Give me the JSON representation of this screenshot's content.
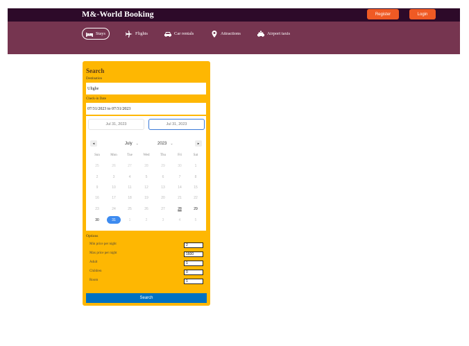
{
  "header": {
    "brand": "M&-World Booking",
    "register_label": "Register",
    "login_label": "Login",
    "colors": {
      "topbar": "#2d0a29",
      "nav": "#763550",
      "button": "#f05a24"
    }
  },
  "nav": {
    "items": [
      {
        "label": "Stays",
        "icon": "bed-icon",
        "active": true
      },
      {
        "label": "Flights",
        "icon": "plane-icon",
        "active": false
      },
      {
        "label": "Car rentals",
        "icon": "car-icon",
        "active": false
      },
      {
        "label": "Attractions",
        "icon": "pin-icon",
        "active": false
      },
      {
        "label": "Airport taxis",
        "icon": "taxi-icon",
        "active": false
      }
    ]
  },
  "search": {
    "title": "Search",
    "destination_label": "Destination",
    "destination_value": "Ulighe",
    "checkin_label": "Check-in Date",
    "checkin_value": "07/31/2023 to 07/31/2023",
    "calendar": {
      "start_tab": "Jul 31, 2023",
      "end_tab": "Jul 31, 2023",
      "prev": "◂",
      "next": "▸",
      "month": "July",
      "year": "2023",
      "weekdays": [
        "Sun",
        "Mon",
        "Tue",
        "Wed",
        "Thu",
        "Fri",
        "Sat"
      ],
      "weeks": [
        [
          "25",
          "26",
          "27",
          "28",
          "29",
          "30",
          "1"
        ],
        [
          "2",
          "3",
          "4",
          "5",
          "6",
          "7",
          "8"
        ],
        [
          "9",
          "10",
          "11",
          "12",
          "13",
          "14",
          "15"
        ],
        [
          "16",
          "17",
          "18",
          "19",
          "20",
          "21",
          "22"
        ],
        [
          "23",
          "24",
          "25",
          "26",
          "27",
          "28",
          "29"
        ],
        [
          "30",
          "31",
          "1",
          "2",
          "3",
          "4",
          "5"
        ]
      ],
      "today": "28",
      "selected": "31"
    },
    "options": {
      "title": "Options",
      "min_price_label": "Min price per night",
      "min_price_value": "2",
      "max_price_label": "Max price per night",
      "max_price_value": "1600",
      "adult_label": "Adult",
      "adult_value": "1",
      "children_label": "Children",
      "children_value": "0",
      "room_label": "Room",
      "room_value": "1"
    },
    "button_label": "Search",
    "colors": {
      "panel": "#feb702",
      "button": "#0071c2",
      "selected_day": "#3d8bf0"
    }
  }
}
